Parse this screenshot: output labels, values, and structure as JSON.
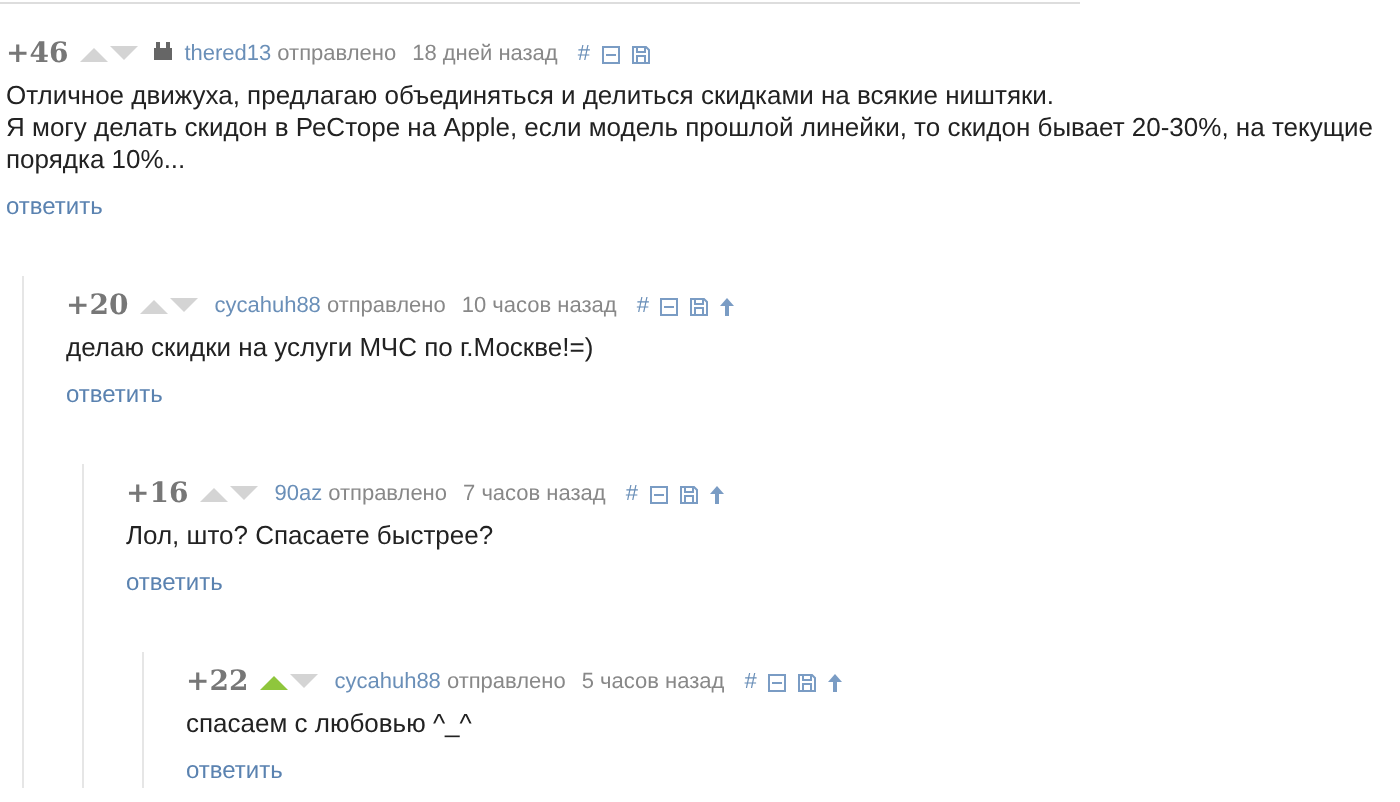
{
  "comments": [
    {
      "score": "+46",
      "upvoted": false,
      "author_badge": true,
      "author": "thered13",
      "action": "отправлено",
      "time": "18 дней назад",
      "anchor": "#",
      "parent_link": false,
      "text": "Отличное движуха, предлагаю объединяться и делиться скидками на всякие ништяки.\nЯ могу делать скидон в РеСторе на Apple, если модель прошлой линейки, то скидон бывает 20-30%, на текущие порядка 10%...",
      "reply": "ответить",
      "children": [
        {
          "score": "+20",
          "upvoted": false,
          "author_badge": false,
          "author": "cycahuh88",
          "action": "отправлено",
          "time": "10 часов назад",
          "anchor": "#",
          "parent_link": true,
          "text": "делаю скидки на услуги МЧС по г.Москве!=)",
          "reply": "ответить",
          "children": [
            {
              "score": "+16",
              "upvoted": false,
              "author_badge": false,
              "author": "90az",
              "action": "отправлено",
              "time": "7 часов назад",
              "anchor": "#",
              "parent_link": true,
              "text": "Лол, што? Спасаете быстрее?",
              "reply": "ответить",
              "children": [
                {
                  "score": "+22",
                  "upvoted": true,
                  "author_badge": false,
                  "author": "cycahuh88",
                  "action": "отправлено",
                  "time": "5 часов назад",
                  "anchor": "#",
                  "parent_link": true,
                  "text": "спасаем с любовью ^_^",
                  "reply": "ответить"
                }
              ]
            }
          ]
        }
      ]
    }
  ]
}
